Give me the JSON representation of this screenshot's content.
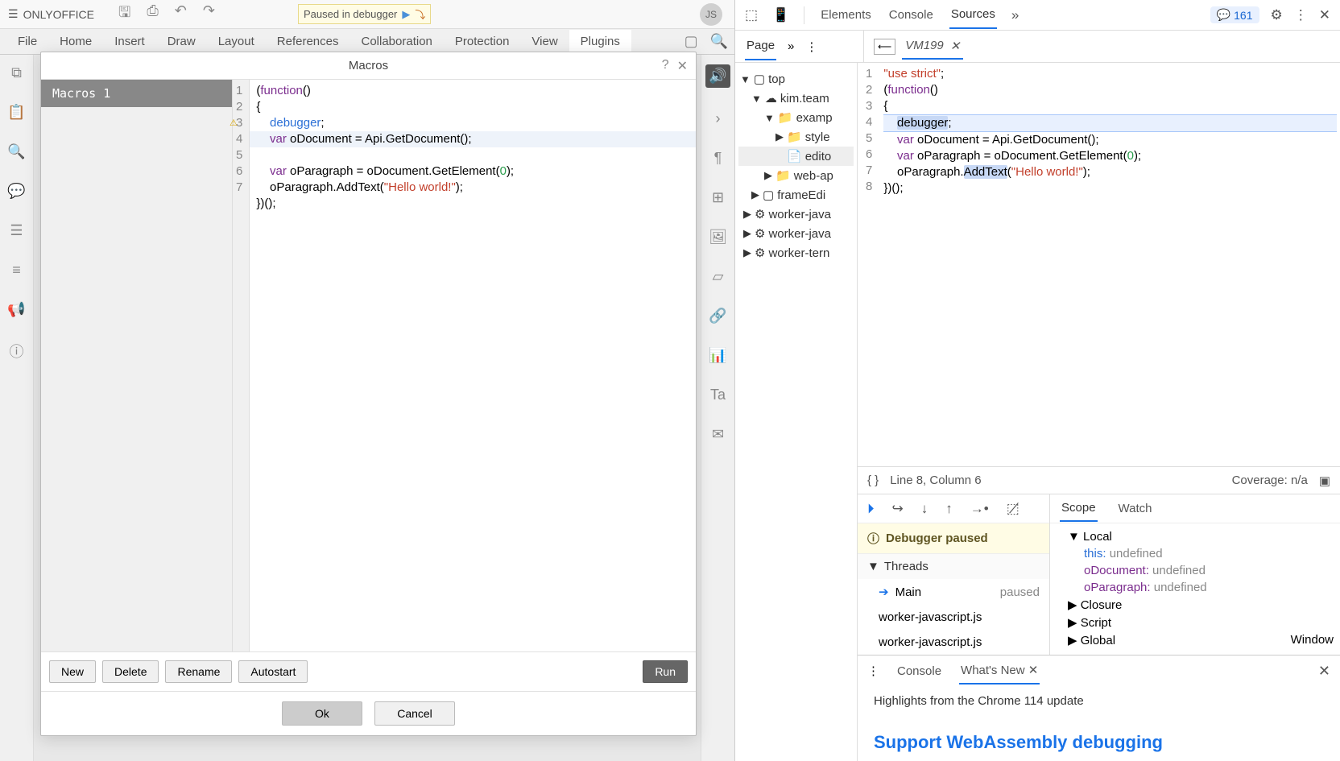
{
  "app": {
    "name": "ONLYOFFICE",
    "user_initials": "JS"
  },
  "paused_badge": {
    "text": "Paused in debugger"
  },
  "menu": {
    "file": "File",
    "home": "Home",
    "insert": "Insert",
    "draw": "Draw",
    "layout": "Layout",
    "references": "References",
    "collaboration": "Collaboration",
    "protection": "Protection",
    "view": "View",
    "plugins": "Plugins"
  },
  "dialog": {
    "title": "Macros",
    "macro_name": "Macros 1",
    "gutter": "1\n2\n3\n4\n5\n6\n7",
    "actions": {
      "new": "New",
      "delete": "Delete",
      "rename": "Rename",
      "autostart": "Autostart",
      "run": "Run"
    },
    "footer": {
      "ok": "Ok",
      "cancel": "Cancel"
    }
  },
  "devtools": {
    "tabs": {
      "elements": "Elements",
      "console": "Console",
      "sources": "Sources"
    },
    "issues_count": "161",
    "page_tab": "Page",
    "file_tab": "VM199",
    "tree": {
      "top": "top",
      "kim": "kim.team",
      "examp": "examp",
      "style": "style",
      "edito": "edito",
      "webap": "web-ap",
      "frame": "frameEdi",
      "wj1": "worker-java",
      "wj2": "worker-java",
      "wt": "worker-tern"
    },
    "src_gutter": "1\n2\n3\n4\n5\n6\n7\n8",
    "status": {
      "pos": "Line 8, Column 6",
      "coverage": "Coverage: n/a"
    },
    "db": {
      "paused": "Debugger paused",
      "threads": "Threads",
      "main": "Main",
      "main_state": "paused",
      "wj1": "worker-javascript.js",
      "wj2": "worker-javascript.js"
    },
    "scope": {
      "tabs": {
        "scope": "Scope",
        "watch": "Watch"
      },
      "local": "Local",
      "this": "this:",
      "this_v": "undefined",
      "od": "oDocument:",
      "od_v": "undefined",
      "op": "oParagraph:",
      "op_v": "undefined",
      "closure": "Closure",
      "script": "Script",
      "global": "Global",
      "global_v": "Window"
    },
    "drawer": {
      "console": "Console",
      "whatsnew": "What's New",
      "highlights": "Highlights from the Chrome 114 update",
      "wasm": "Support WebAssembly debugging"
    }
  }
}
